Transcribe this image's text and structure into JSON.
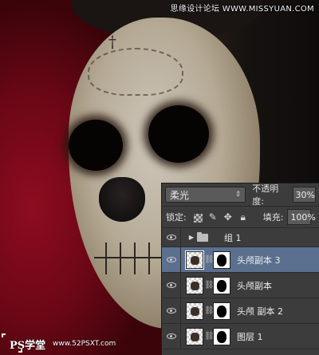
{
  "watermarks": {
    "top_right": "思缘设计论坛 WWW.MISSYUAN.COM",
    "bottom_left": "PS学堂",
    "bottom_url": "www.52PSXT.com"
  },
  "layers_panel": {
    "blend_mode": "柔光",
    "opacity_label": "不透明度:",
    "opacity_value": "30%",
    "lock_label": "锁定:",
    "fill_label": "填充:",
    "fill_value": "100%",
    "layers": [
      {
        "name": "组 1",
        "type": "group",
        "visible": true,
        "selected": false
      },
      {
        "name": "头颅副本 3",
        "type": "layer",
        "visible": true,
        "selected": true
      },
      {
        "name": "头颅副本",
        "type": "layer",
        "visible": true,
        "selected": false
      },
      {
        "name": "头颅 副本 2",
        "type": "layer",
        "visible": true,
        "selected": false
      },
      {
        "name": "图层 1",
        "type": "layer",
        "visible": true,
        "selected": false
      }
    ]
  },
  "colors": {
    "panel_bg": "#3c3c3c",
    "selected_row": "#5b6f8e",
    "background_red": "#8e0c20"
  }
}
